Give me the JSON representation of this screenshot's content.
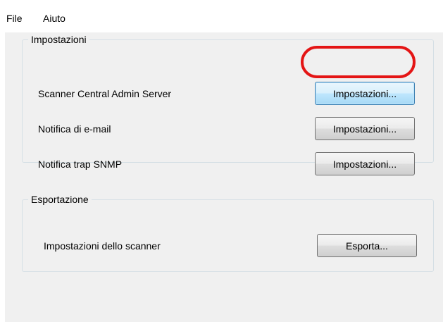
{
  "menu": {
    "items": [
      {
        "label": "File"
      },
      {
        "label": "Aiuto"
      }
    ]
  },
  "settings_group": {
    "title": "Impostazioni",
    "rows": [
      {
        "label": "Scanner Central Admin Server",
        "button": "Impostazioni..."
      },
      {
        "label": "Notifica di e-mail",
        "button": "Impostazioni..."
      },
      {
        "label": "Notifica trap SNMP",
        "button": "Impostazioni..."
      }
    ]
  },
  "export_group": {
    "title": "Esportazione",
    "rows": [
      {
        "label": "Impostazioni dello scanner",
        "button": "Esporta..."
      }
    ]
  },
  "colors": {
    "highlight": "#e41515",
    "focus_border": "#3c7fb1",
    "background": "#f0f0f0"
  }
}
